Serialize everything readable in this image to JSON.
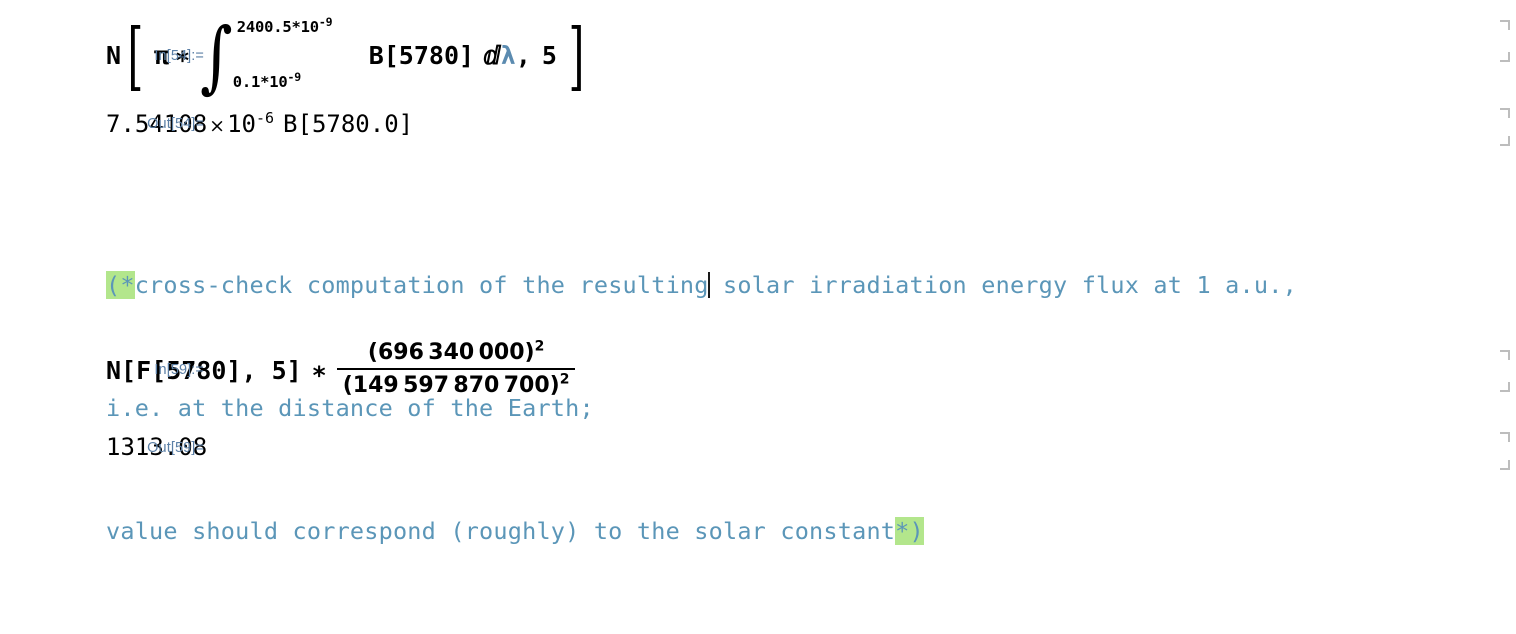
{
  "notebook": {
    "cells": [
      {
        "kind": "input",
        "label": "In[54]:=",
        "expression": {
          "head": "N",
          "open_bracket": "[",
          "pi": "π",
          "times": "∗",
          "integral_sign": "∫",
          "upper_limit_base": "2400.5*10",
          "upper_limit_exp": "-9",
          "lower_limit_base": "0.1*10",
          "lower_limit_exp": "-9",
          "integrand": "B[5780]",
          "differential_d": "ⅆ",
          "variable": "λ",
          "separator": ",",
          "precision": "5",
          "close_bracket": "]"
        }
      },
      {
        "kind": "output",
        "label": "Out[54]=",
        "mantissa": "7.54108",
        "times_symbol": "×",
        "base": "10",
        "exponent": "-6",
        "factor": "B[5780.0]"
      },
      {
        "kind": "comment",
        "open_delimiter": "(*",
        "close_delimiter": "*)",
        "lines": [
          {
            "before_caret": "cross-check computation of the resulting",
            "after_caret": " solar irradiation energy flux at 1 a.u.,"
          },
          {
            "text": "i.e. at the distance of the Earth;"
          },
          {
            "text": "value should correspond (roughly) to the solar constant"
          }
        ]
      },
      {
        "kind": "input",
        "label": "In[59]:=",
        "expression": {
          "call": "N[F[5780], 5]",
          "times": "∗",
          "numerator": "696 340 000",
          "numerator_exp": "2",
          "denominator": "149 597 870 700",
          "denominator_exp": "2",
          "paren_open": "(",
          "paren_close": ")"
        }
      },
      {
        "kind": "output",
        "label": "Out[59]=",
        "value": "1313.08"
      }
    ]
  },
  "colors": {
    "io_label": "#5b7fa6",
    "comment_text": "#5b96b8",
    "comment_highlight": "#b3e68c",
    "symbol_blue": "#5b8bb0",
    "cell_bracket": "#bdbdbd",
    "background": "#ffffff"
  }
}
